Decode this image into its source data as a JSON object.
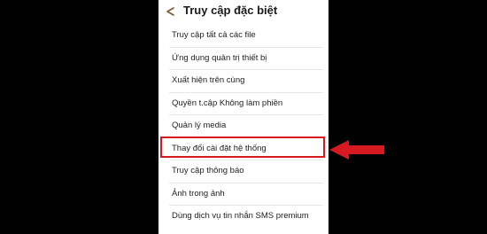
{
  "header": {
    "title": "Truy cập đặc biệt",
    "back_icon": "back-arrow-icon"
  },
  "menu": {
    "items": [
      {
        "label": "Truy cập tất cả các file"
      },
      {
        "label": "Ứng dụng quản trị thiết bị"
      },
      {
        "label": "Xuất hiện trên cùng"
      },
      {
        "label": "Quyền t.cập Không làm phiền"
      },
      {
        "label": "Quản lý media"
      },
      {
        "label": "Thay đổi cài đặt hệ thống"
      },
      {
        "label": "Truy cập thông báo"
      },
      {
        "label": "Ảnh trong ảnh"
      },
      {
        "label": "Dùng dịch vụ tin nhắn SMS premium"
      }
    ]
  },
  "annotation": {
    "highlight_color": "#d71921",
    "pointer_icon": "red-arrow-icon"
  }
}
